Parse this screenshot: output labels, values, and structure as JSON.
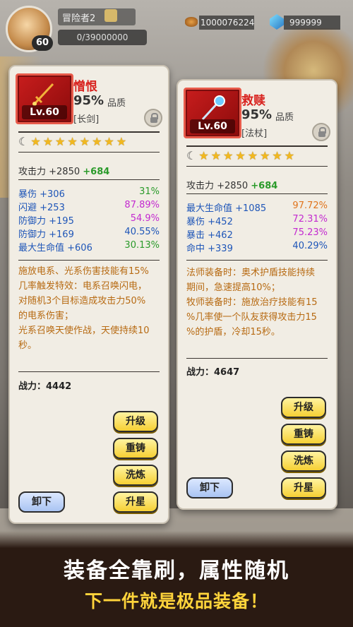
{
  "hud": {
    "player_name": "冒险者2",
    "level": "60",
    "exp": "0/39000000",
    "gold": "1000076224",
    "gems": "999999"
  },
  "left_card": {
    "name": "憎恨",
    "quality_pct": "95%",
    "quality_label": "品质",
    "type": "[长剑]",
    "level": "Lv.60",
    "stars": 8,
    "attack": "攻击力 +2850",
    "attack_bonus": "+684",
    "stats": [
      {
        "name": "暴伤",
        "value": "+306",
        "pct": "31%",
        "pct_color": "#2a9a2a"
      },
      {
        "name": "闪避",
        "value": "+253",
        "pct": "87.89%",
        "pct_color": "#c32ad0"
      },
      {
        "name": "防御力",
        "value": "+195",
        "pct": "54.9%",
        "pct_color": "#c32ad0"
      },
      {
        "name": "防御力",
        "value": "+169",
        "pct": "40.55%",
        "pct_color": "#1f56b8"
      },
      {
        "name": "最大生命值",
        "value": "+606",
        "pct": "30.13%",
        "pct_color": "#2a9a2a"
      }
    ],
    "desc": [
      "施放电系、光系伤害技能有15%",
      "几率触发特效：电系召唤闪电，",
      "对随机3个目标造成攻击力50%",
      "的电系伤害；",
      "光系召唤天使作战，天使持续10",
      "秒。"
    ],
    "power": "战力：4442",
    "buttons": {
      "upgrade": "升级",
      "recast": "重铸",
      "refine": "洗炼",
      "star_up": "升星",
      "unload": "卸下"
    }
  },
  "right_card": {
    "name": "救赎",
    "quality_pct": "95%",
    "quality_label": "品质",
    "type": "[法杖]",
    "level": "Lv.60",
    "stars": 8,
    "attack": "攻击力 +2850",
    "attack_bonus": "+684",
    "stats": [
      {
        "name": "最大生命值",
        "value": "+1085",
        "pct": "97.72%",
        "pct_color": "#e0741c"
      },
      {
        "name": "暴伤",
        "value": "+452",
        "pct": "72.31%",
        "pct_color": "#c32ad0"
      },
      {
        "name": "暴击",
        "value": "+462",
        "pct": "75.23%",
        "pct_color": "#c32ad0"
      },
      {
        "name": "命中",
        "value": "+339",
        "pct": "40.29%",
        "pct_color": "#1f56b8"
      }
    ],
    "desc": [
      "法师装备时：奥术护盾技能持续",
      "期间，急速提高10%；",
      "牧师装备时：施放治疗技能有15",
      "%几率使一个队友获得攻击力15",
      "%的护盾，冷却15秒。"
    ],
    "power": "战力：4647",
    "buttons": {
      "upgrade": "升级",
      "recast": "重铸",
      "refine": "洗炼",
      "star_up": "升星",
      "unload": "卸下"
    }
  },
  "banner": {
    "line1": "装备全靠刷，属性随机",
    "line2": "下一件就是极品装备！"
  },
  "colors": {
    "accent_red": "#d8231f",
    "button_yellow": "#f6d034",
    "bonus_green": "#2a9a2a",
    "stat_blue": "#1f56b8"
  }
}
